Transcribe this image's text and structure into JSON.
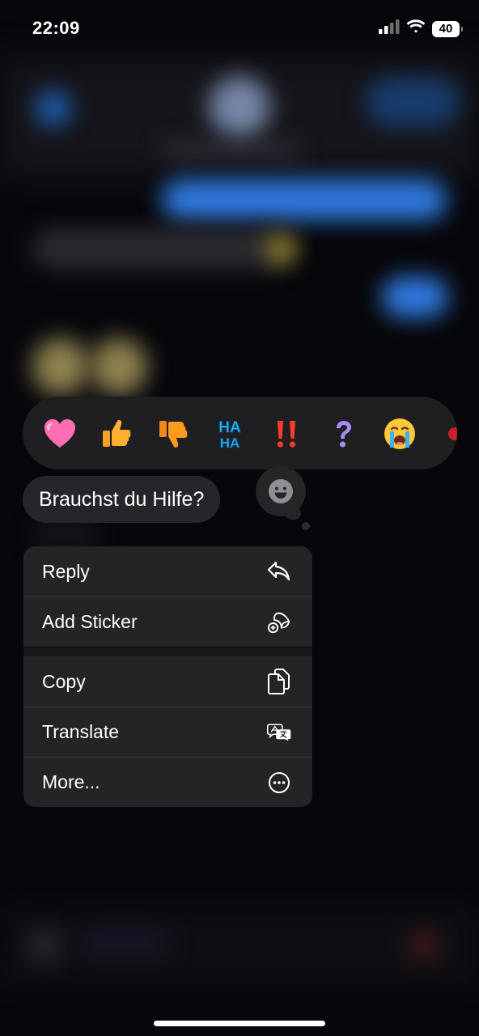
{
  "status_bar": {
    "time": "22:09",
    "battery": "40"
  },
  "reactions": [
    {
      "name": "heart",
      "color": "#ff5fa8"
    },
    {
      "name": "thumbs-up",
      "color": "#ffb02e"
    },
    {
      "name": "thumbs-down",
      "color": "#ff9a1f"
    },
    {
      "name": "haha",
      "text_top": "HA",
      "text_bottom": "HA",
      "color": "#22b4f5"
    },
    {
      "name": "double-exclamation",
      "color": "#ff3b30"
    },
    {
      "name": "question-mark",
      "color": "#a58cf2"
    },
    {
      "name": "crying-face",
      "color": "#ffc83a"
    }
  ],
  "message": {
    "text": "Brauchst du Hilfe?"
  },
  "menu": {
    "group1": [
      {
        "label": "Reply",
        "icon": "reply-icon"
      },
      {
        "label": "Add Sticker",
        "icon": "add-sticker-icon"
      }
    ],
    "group2": [
      {
        "label": "Copy",
        "icon": "copy-icon"
      },
      {
        "label": "Translate",
        "icon": "translate-icon"
      },
      {
        "label": "More...",
        "icon": "more-icon"
      }
    ]
  },
  "colors": {
    "background": "#07070b",
    "menu": "#242427",
    "bubble": "#26262a",
    "blue": "#2f7ae0"
  }
}
